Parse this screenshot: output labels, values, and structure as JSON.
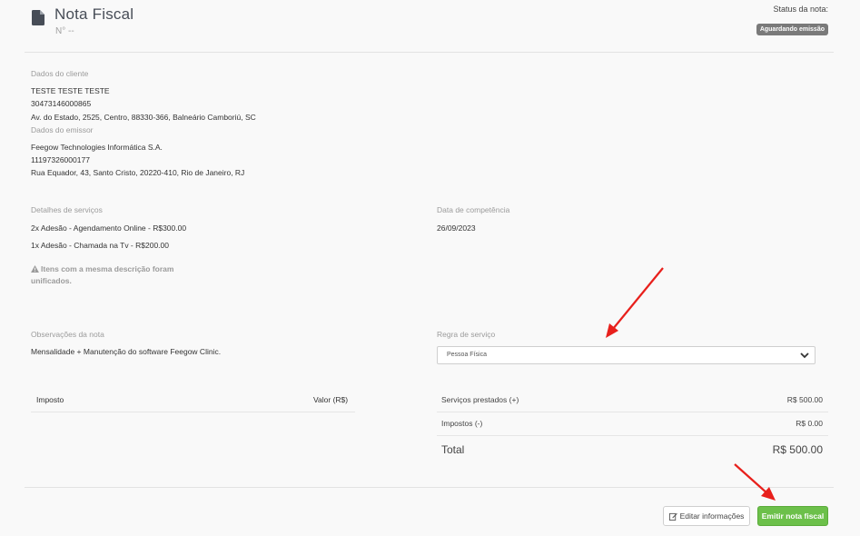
{
  "header": {
    "title": "Nota Fiscal",
    "number": "N° --",
    "status_label": "Status da nota:",
    "status_badge": "Aguardando emissão"
  },
  "client": {
    "label": "Dados do cliente",
    "name": "TESTE TESTE TESTE",
    "doc": "30473146000865",
    "address": "Av. do Estado, 2525, Centro, 88330-366, Balneário Camboriú, SC"
  },
  "issuer": {
    "label": "Dados do emissor",
    "name": "Feegow Technologies Informática S.A.",
    "doc": "11197326000177",
    "address": "Rua Equador, 43, Santo Cristo, 20220-410, Rio de Janeiro, RJ"
  },
  "services": {
    "label": "Detalhes de serviços",
    "items": [
      "2x Adesão - Agendamento Online - R$300.00",
      "1x Adesão - Chamada na Tv - R$200.00"
    ],
    "warning": "Itens com a mesma descrição foram unificados."
  },
  "competence": {
    "label": "Data de competência",
    "value": "26/09/2023"
  },
  "notes": {
    "label": "Observações da nota",
    "value": "Mensalidade + Manutenção do software Feegow Clinic."
  },
  "service_rule": {
    "label": "Regra de serviço",
    "selected": "Pessoa Física"
  },
  "tax_table": {
    "col_tax": "Imposto",
    "col_value": "Valor (R$)"
  },
  "summary": {
    "services_label": "Serviços prestados (+)",
    "services_value": "R$ 500.00",
    "taxes_label": "Impostos (-)",
    "taxes_value": "R$ 0.00",
    "total_label": "Total",
    "total_value": "R$ 500.00"
  },
  "actions": {
    "edit_label": "Editar informações",
    "emit_label": "Emitir nota fiscal"
  },
  "colors": {
    "emit_button": "#6cc04a",
    "annotation_arrow": "#e8201c",
    "status_badge": "#7a7a7a"
  }
}
